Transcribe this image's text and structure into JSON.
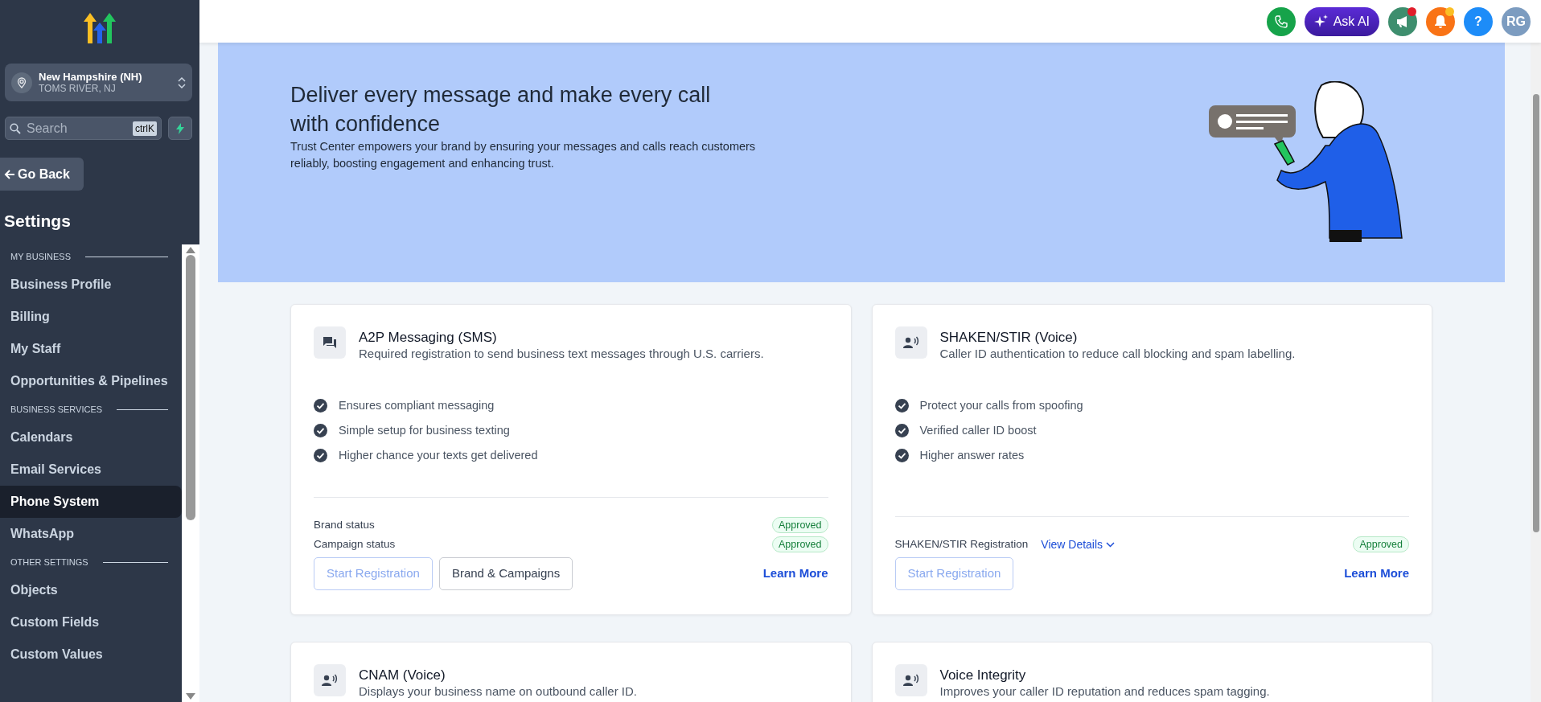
{
  "sidebar": {
    "location": {
      "name": "New Hampshire (NH)",
      "address": "TOMS RIVER, NJ"
    },
    "search": {
      "placeholder": "Search",
      "shortcut": "ctrlK"
    },
    "back_button": "Go Back",
    "title": "Settings",
    "sections": [
      {
        "heading": "MY BUSINESS",
        "items": [
          {
            "label": "Business Profile",
            "selected": false
          },
          {
            "label": "Billing",
            "selected": false
          },
          {
            "label": "My Staff",
            "selected": false
          },
          {
            "label": "Opportunities & Pipelines",
            "selected": false
          }
        ]
      },
      {
        "heading": "BUSINESS SERVICES",
        "items": [
          {
            "label": "Calendars",
            "selected": false
          },
          {
            "label": "Email Services",
            "selected": false
          },
          {
            "label": "Phone System",
            "selected": true
          },
          {
            "label": "WhatsApp",
            "selected": false
          }
        ]
      },
      {
        "heading": "OTHER SETTINGS",
        "items": [
          {
            "label": "Objects",
            "selected": false
          },
          {
            "label": "Custom Fields",
            "selected": false
          },
          {
            "label": "Custom Values",
            "selected": false
          }
        ]
      }
    ]
  },
  "header": {
    "actions": [
      {
        "kind": "phone",
        "dot": false
      },
      {
        "kind": "ask_ai",
        "label": "Ask AI",
        "dot": false
      },
      {
        "kind": "megaphone",
        "dot": true
      },
      {
        "kind": "bell",
        "dot": true
      },
      {
        "kind": "help",
        "label": "?",
        "dot": false
      },
      {
        "kind": "avatar",
        "label": "RG",
        "dot": false
      }
    ]
  },
  "banner": {
    "title": "Deliver every message and make every call with confidence",
    "text": "Trust Center empowers your brand by ensuring your messages and calls reach customers reliably, boosting engagement and enhancing trust."
  },
  "cards": [
    {
      "kind": "chat",
      "title": "A2P Messaging (SMS)",
      "description": "Required registration to send business text messages through U.S. carriers.",
      "features": [
        "Ensures compliant messaging",
        "Simple setup for business texting",
        "Higher chance your texts get delivered"
      ],
      "statuses": [
        {
          "label": "Brand status",
          "status": "Approved"
        },
        {
          "label": "Campaign status",
          "status": "Approved"
        }
      ],
      "buttons": [
        {
          "label": "Start Registration",
          "disabled": true
        },
        {
          "label": "Brand & Campaigns",
          "disabled": false
        }
      ],
      "link": "Learn More"
    },
    {
      "kind": "voice",
      "title": "SHAKEN/STIR (Voice)",
      "description": "Caller ID authentication to reduce call blocking and spam labelling.",
      "features": [
        "Protect your calls from spoofing",
        "Verified caller ID boost",
        "Higher answer rates"
      ],
      "statuses": [
        {
          "label": "SHAKEN/STIR Registration",
          "details": "View Details",
          "status": "Approved"
        }
      ],
      "buttons": [
        {
          "label": "Start Registration",
          "disabled": true
        }
      ],
      "link": "Learn More"
    },
    {
      "kind": "voice",
      "title": "CNAM (Voice)",
      "description": "Displays your business name on outbound caller ID."
    },
    {
      "kind": "voice",
      "title": "Voice Integrity",
      "description": "Improves your caller ID reputation and reduces spam tagging."
    }
  ]
}
